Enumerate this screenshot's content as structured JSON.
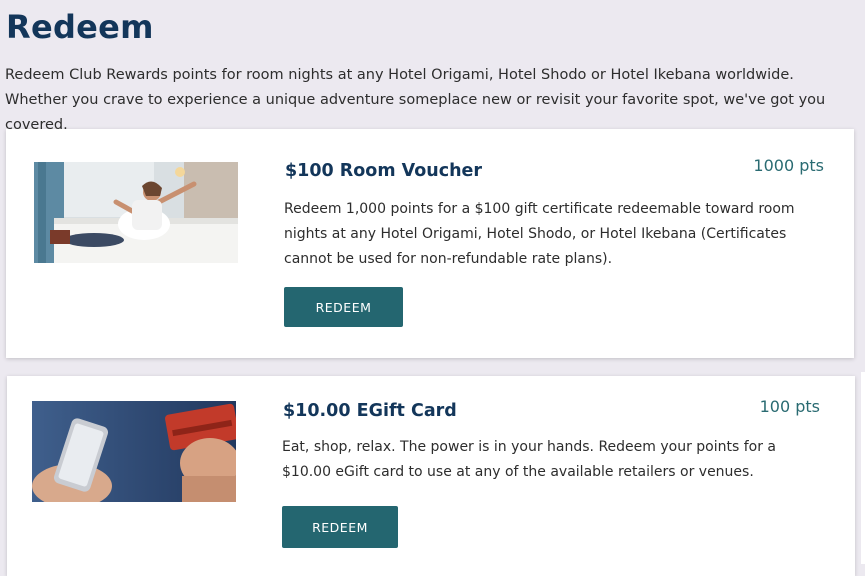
{
  "page": {
    "title": "Redeem",
    "intro": "Redeem Club Rewards points for room nights at any Hotel Origami, Hotel Shodo or Hotel Ikebana worldwide. Whether you crave to experience a unique adventure someplace new or revisit your favorite spot, we've got you covered."
  },
  "rewards": [
    {
      "title": "$100 Room Voucher",
      "points": "1000 pts",
      "description": "Redeem 1,000 points for a $100 gift certificate redeemable toward room nights at any Hotel Origami, Hotel Shodo, or Hotel Ikebana (Certificates cannot be used for non-refundable rate plans).",
      "button_label": "REDEEM",
      "image": "woman-on-hotel-bed-photo"
    },
    {
      "title": "$10.00 EGift Card",
      "points": "100 pts",
      "description": "Eat, shop, relax. The power is in your hands. Redeem your points for a $10.00 eGift card to use at any of the available retailers or venues.",
      "button_label": "REDEEM",
      "image": "phone-and-credit-card-photo"
    }
  ],
  "colors": {
    "background": "#ece9f0",
    "title": "#13365a",
    "accent": "#246670",
    "points": "#2a6b72"
  }
}
